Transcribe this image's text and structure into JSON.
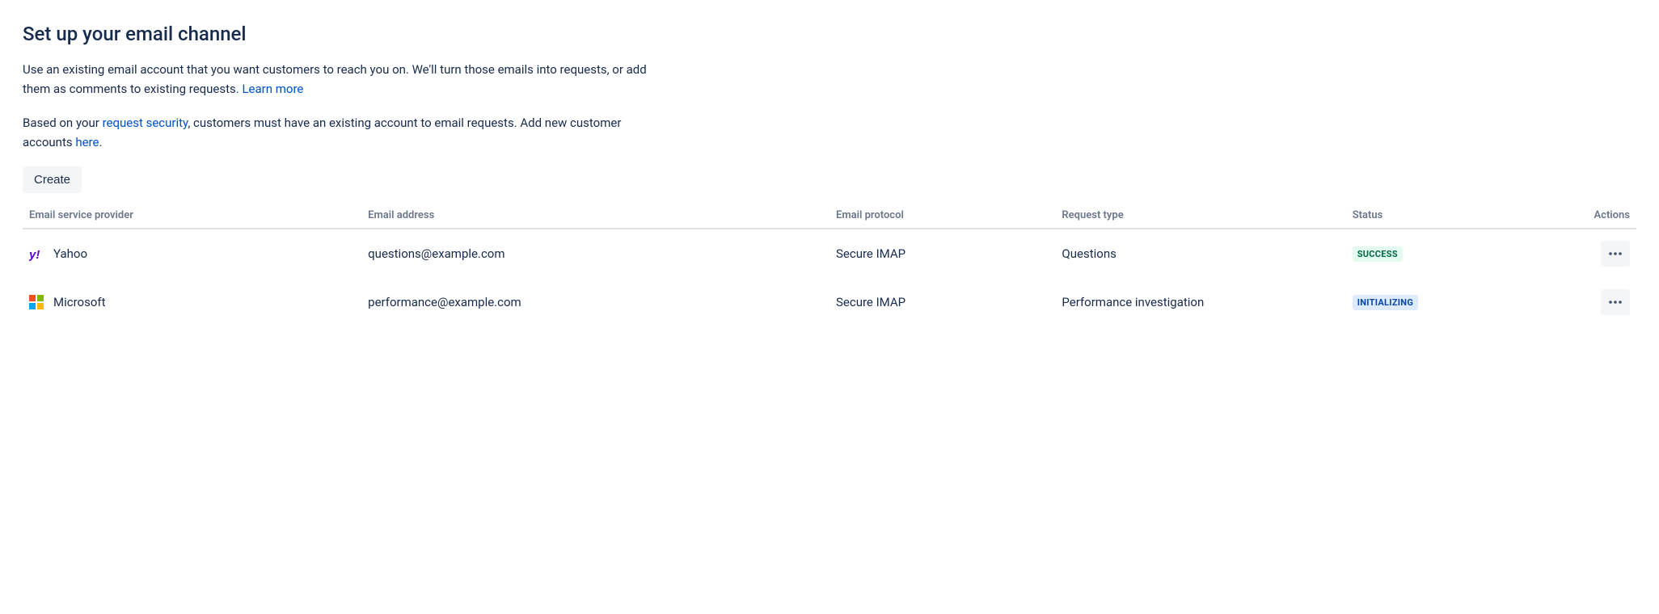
{
  "header": {
    "title": "Set up your email channel"
  },
  "intro": {
    "p1_a": "Use an existing email account that you want customers to reach you on. We'll turn those emails into requests, or add them as comments to existing requests. ",
    "p1_link": "Learn more",
    "p2_a": "Based on your ",
    "p2_link1": "request security",
    "p2_b": ", customers must have an existing account to email requests. Add new customer accounts ",
    "p2_link2": "here",
    "p2_c": "."
  },
  "buttons": {
    "create": "Create"
  },
  "table": {
    "headers": {
      "provider": "Email service provider",
      "email": "Email address",
      "protocol": "Email protocol",
      "request_type": "Request type",
      "status": "Status",
      "actions": "Actions"
    },
    "rows": [
      {
        "provider_icon": "yahoo",
        "provider": "Yahoo",
        "email": "questions@example.com",
        "protocol": "Secure IMAP",
        "request_type": "Questions",
        "status_label": "SUCCESS",
        "status_variant": "success"
      },
      {
        "provider_icon": "microsoft",
        "provider": "Microsoft",
        "email": "performance@example.com",
        "protocol": "Secure IMAP",
        "request_type": "Performance investigation",
        "status_label": "INITIALIZING",
        "status_variant": "info"
      }
    ]
  }
}
